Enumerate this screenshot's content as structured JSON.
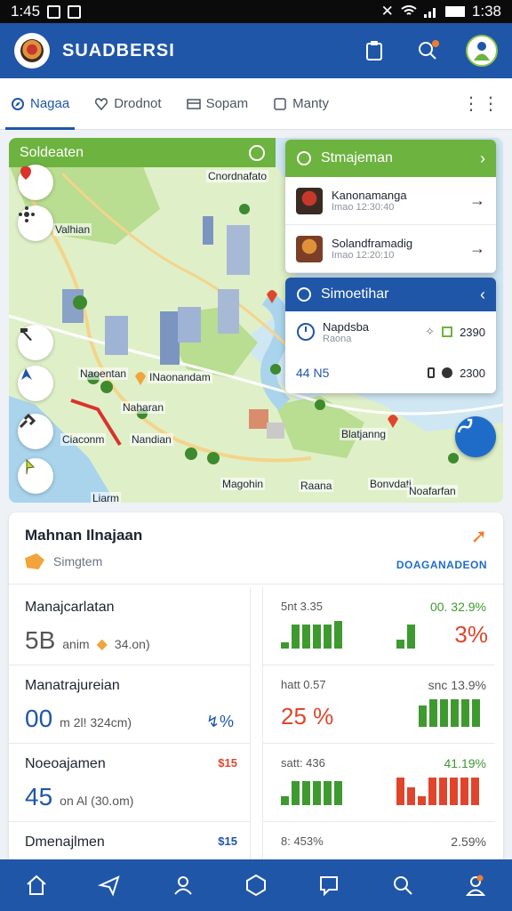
{
  "status_bar": {
    "time_left": "1:45",
    "time_right": "1:38"
  },
  "app": {
    "title": "SUADBERSI"
  },
  "tabs": [
    {
      "label": "Nagaa",
      "active": true,
      "icon": "compass-icon"
    },
    {
      "label": "Drodnot",
      "active": false,
      "icon": "heart-icon"
    },
    {
      "label": "Sopam",
      "active": false,
      "icon": "card-icon"
    },
    {
      "label": "Manty",
      "active": false,
      "icon": "square-icon"
    }
  ],
  "map": {
    "header": "Soldeaten",
    "labels": [
      "Cnordnafato",
      "Valhian",
      "Naoentan",
      "INaonandam",
      "Naharan",
      "Ciaconm",
      "Nandian",
      "Magohin",
      "Raana",
      "Bonvdati",
      "Blatjanng",
      "Noafarfan",
      "Liarm"
    ]
  },
  "panel_top": {
    "title": "Stmajeman",
    "items": [
      {
        "title": "Kanonamanga",
        "sub": "Imao 12:30:40"
      },
      {
        "title": "Solandframadig",
        "sub": "Imao 12:20:10"
      }
    ]
  },
  "panel_info": {
    "title": "Simoetihar",
    "rows": [
      {
        "label": "Napdsba",
        "sub": "Raona",
        "value": "2390"
      },
      {
        "label": "44 N5",
        "sub": "",
        "value": "2300"
      }
    ]
  },
  "card": {
    "title": "Mahnan Ilnajaan",
    "subtitle": "Simgtem",
    "link": "DOAGANADEON",
    "metrics": [
      {
        "label": "Manajcarlatan",
        "big": "5B",
        "small": "anim",
        "extra": "34.on)"
      },
      {
        "label": "Manatrajureian",
        "big": "00",
        "small": "m 2l! 324cm)",
        "extra": ""
      },
      {
        "label": "Noeoajamen",
        "big": "45",
        "small": "on Al (30.om)",
        "tag": "$15"
      },
      {
        "label": "Dmenajlmen",
        "big": "",
        "small": "",
        "tag": "$15"
      }
    ],
    "stats": [
      {
        "left": "5nt 3.35",
        "right": "00. 32.9%",
        "pct": "3%",
        "bars": [
          0.2,
          0.8,
          0.8,
          0.8,
          0.8,
          0.9
        ],
        "bars2": [
          0.3,
          0.8
        ]
      },
      {
        "left": "hatt 0.57",
        "right": "snc 13.9%",
        "pct": "25 %",
        "bars": [
          0.7,
          0.9,
          0.9,
          0.9,
          0.9,
          0.9
        ]
      },
      {
        "left": "satt: 436",
        "right": "41.19%",
        "pct": "",
        "bars": [
          0.3,
          0.8,
          0.8,
          0.8,
          0.8,
          0.8
        ],
        "bars2": [
          0.9,
          0.6,
          0.3,
          0.9,
          0.9,
          0.9,
          0.9,
          0.9
        ]
      },
      {
        "left": "8: 453%",
        "right": "2.59%"
      }
    ]
  },
  "colors": {
    "primary": "#1f56a8",
    "green": "#6db33f",
    "orange": "#f07c2c",
    "red": "#e0452c"
  },
  "bottom_nav": [
    "home-icon",
    "navigate-icon",
    "people-icon",
    "hexagon-icon",
    "chat-icon",
    "search-icon",
    "profile-icon"
  ]
}
